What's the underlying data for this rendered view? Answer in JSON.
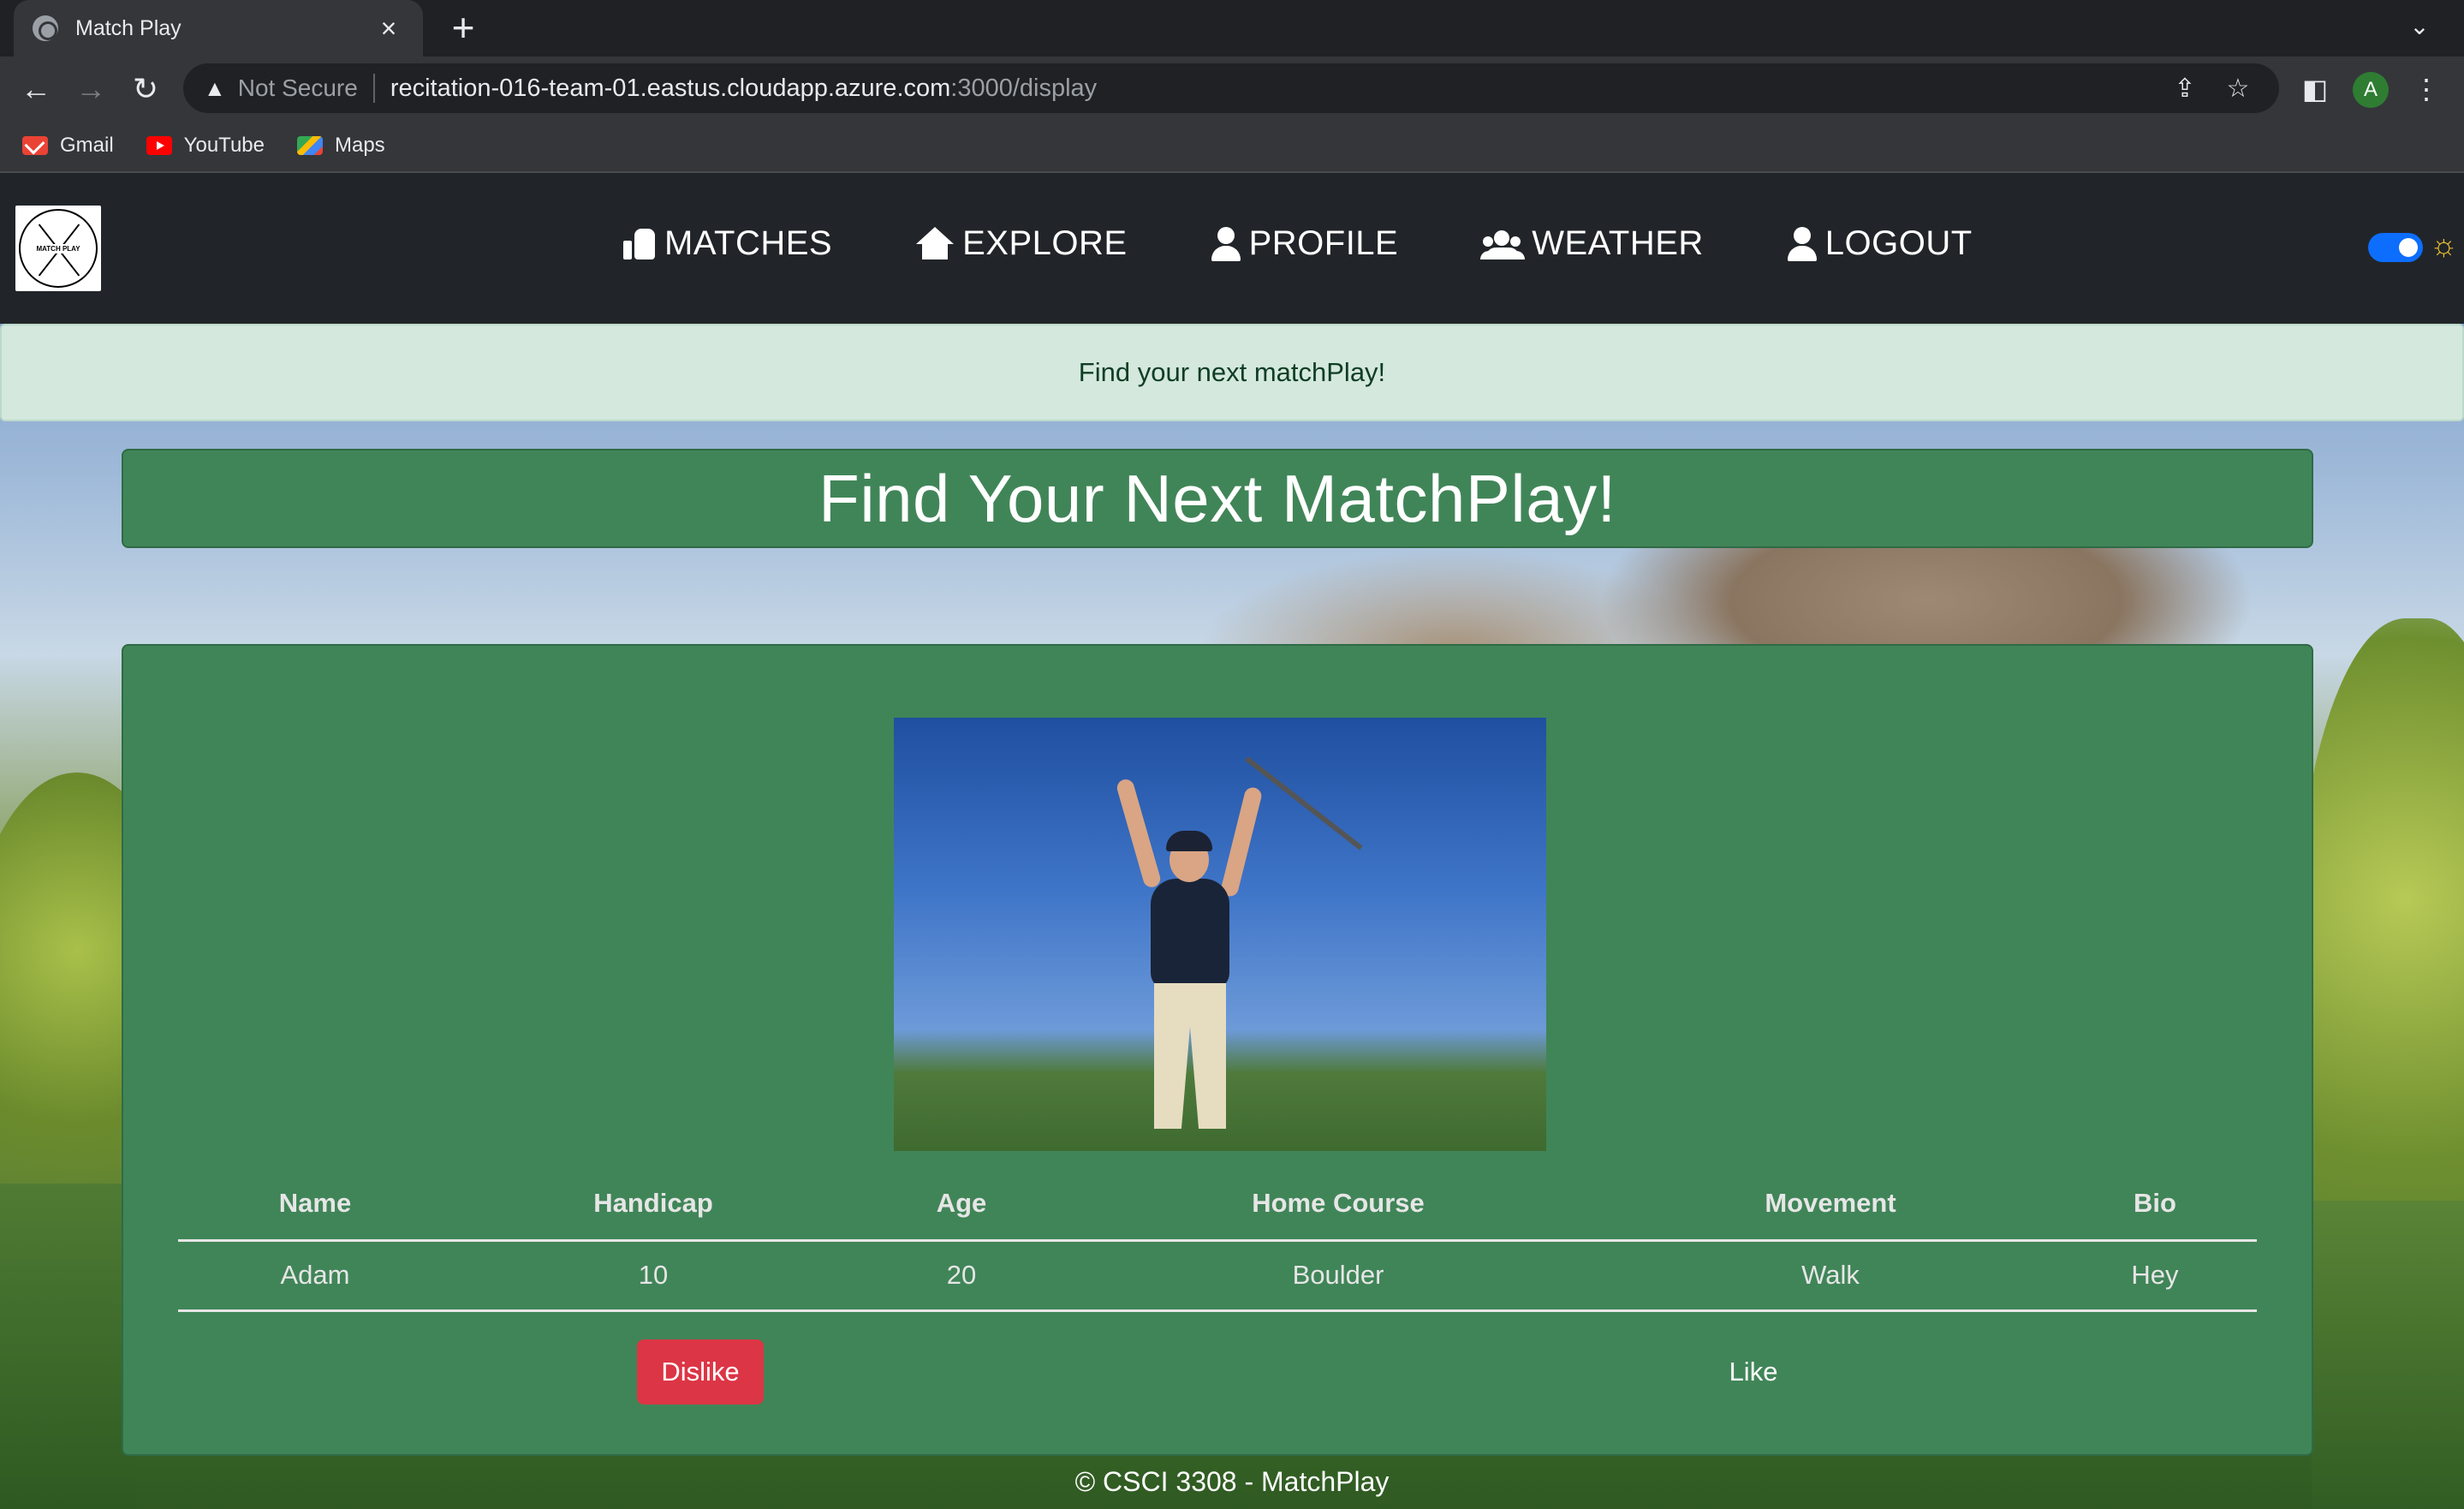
{
  "browser": {
    "tab_title": "Match Play",
    "new_tab_label": "+",
    "omnibox": {
      "security_label": "Not Secure",
      "host": "recitation-016-team-01.eastus.cloudapp.azure.com",
      "path": ":3000/display"
    },
    "profile_initial": "A",
    "bookmarks": [
      {
        "label": "Gmail",
        "icon": "gmail-icon"
      },
      {
        "label": "YouTube",
        "icon": "youtube-icon"
      },
      {
        "label": "Maps",
        "icon": "maps-icon"
      }
    ]
  },
  "navbar": {
    "logo_text": "MATCH PLAY",
    "links": [
      {
        "label": "MATCHES",
        "icon": "thumbs-up-icon"
      },
      {
        "label": "EXPLORE",
        "icon": "home-icon"
      },
      {
        "label": "PROFILE",
        "icon": "user-icon"
      },
      {
        "label": "WEATHER",
        "icon": "users-icon"
      },
      {
        "label": "LOGOUT",
        "icon": "user-icon"
      }
    ],
    "theme_toggle_on": true
  },
  "alert": {
    "message": "Find your next matchPlay!"
  },
  "main": {
    "title": "Find Your Next MatchPlay!",
    "table": {
      "headers": [
        "Name",
        "Handicap",
        "Age",
        "Home Course",
        "Movement",
        "Bio"
      ],
      "row": [
        "Adam",
        "10",
        "20",
        "Boulder",
        "Walk",
        "Hey"
      ]
    },
    "dislike_label": "Dislike",
    "like_label": "Like"
  },
  "footer": {
    "text": "© CSCI 3308 - MatchPlay"
  },
  "colors": {
    "card_green": "#408558",
    "navbar_dark": "#212529",
    "alert_bg": "#d4e8dd",
    "dislike_red": "#dc3545",
    "toggle_blue": "#0d6efd"
  }
}
